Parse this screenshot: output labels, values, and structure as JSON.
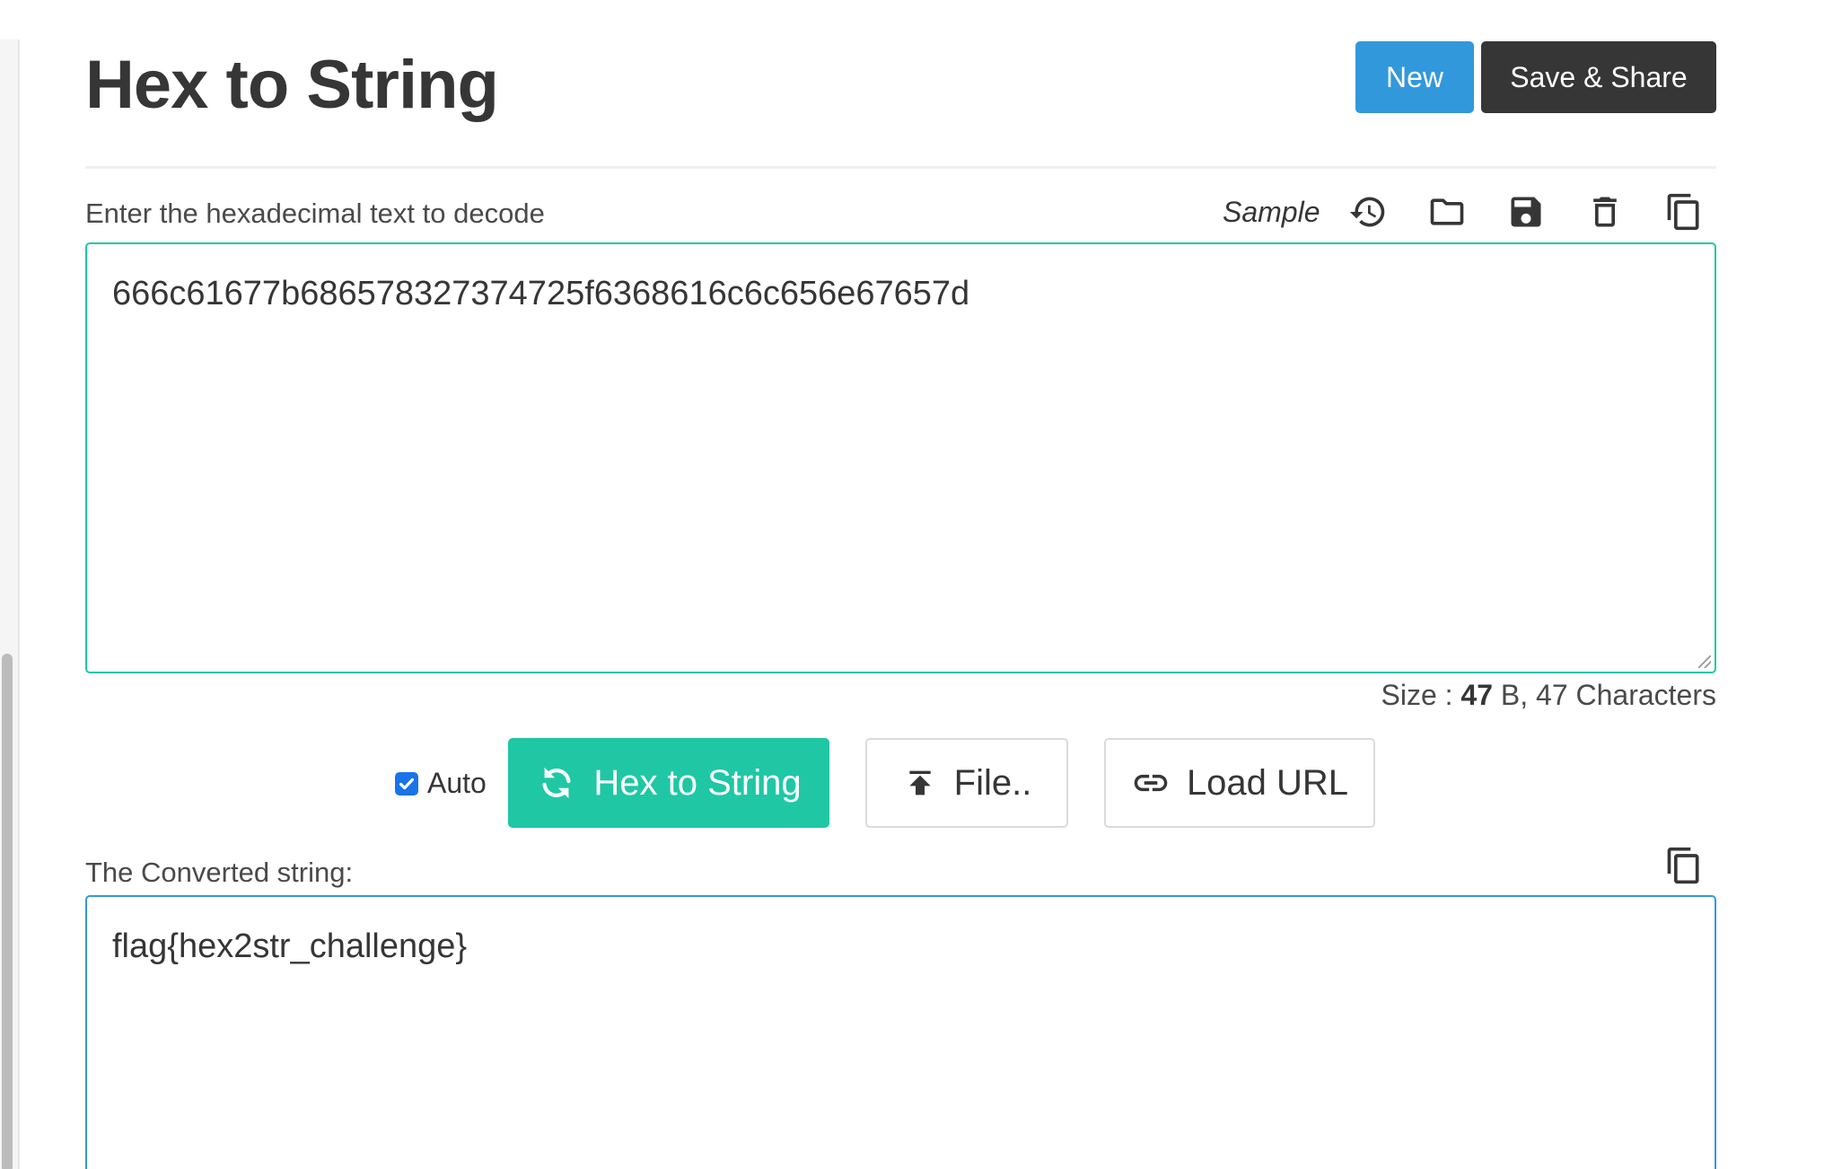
{
  "header": {
    "title": "Hex to String",
    "new_label": "New",
    "save_share_label": "Save & Share"
  },
  "input": {
    "label": "Enter the hexadecimal text to decode",
    "sample_label": "Sample",
    "value": "666c61677b686578327374725f6368616c6c656e67657d",
    "toolbar_icons": [
      "history-icon",
      "folder-icon",
      "save-icon",
      "trash-icon",
      "copy-icon"
    ],
    "size_prefix": "Size : ",
    "size_bytes": "47",
    "size_suffix": " B, 47 Characters"
  },
  "actions": {
    "auto_label": "Auto",
    "auto_checked": true,
    "convert_label": "Hex to String",
    "file_label": "File..",
    "load_url_label": "Load URL"
  },
  "output": {
    "label": "The Converted string:",
    "value": "flag{hex2str_challenge}"
  },
  "colors": {
    "primary_blue": "#3298dc",
    "dark": "#363636",
    "teal": "#1fc7a5"
  }
}
